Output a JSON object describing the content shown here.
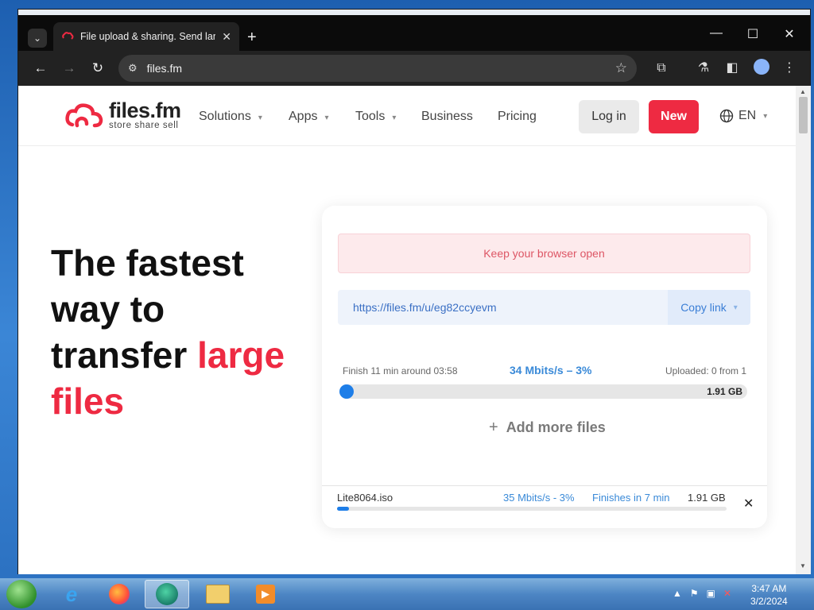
{
  "browser": {
    "tab_title": "File upload & sharing. Send lar",
    "url": "files.fm",
    "new_tab": "+",
    "window_controls": {
      "minimize": "—",
      "maximize": "☐",
      "close": "✕"
    }
  },
  "site": {
    "brand": "files.fm",
    "tagline": "store share sell",
    "nav": [
      "Solutions",
      "Apps",
      "Tools",
      "Business",
      "Pricing"
    ],
    "login": "Log in",
    "new": "New",
    "language": "EN",
    "brand_color": "#ee2a42"
  },
  "hero": {
    "line1": "The fastest",
    "line2": "way to",
    "line3_plain": "transfer ",
    "line3_accent": "large",
    "line4_accent": "files"
  },
  "upload": {
    "warning": "Keep your browser open",
    "share_link": "https://files.fm/u/eg82ccyevm",
    "copy_label": "Copy link",
    "finish_text": "Finish 11 min around 03:58",
    "speed_text": "34 Mbits/s – 3%",
    "uploaded_text": "Uploaded: 0 from 1",
    "total_size": "1.91 GB",
    "progress_percent": 3,
    "add_more": "Add more files"
  },
  "file": {
    "name": "Lite8064.iso",
    "speed": "35 Mbits/s - 3%",
    "finishes": "Finishes in 7 min",
    "size": "1.91 GB",
    "progress_percent": 3
  },
  "taskbar": {
    "time": "3:47 AM",
    "date": "3/2/2024",
    "apps": [
      "internet-explorer-icon",
      "firefox-icon",
      "app-icon",
      "file-explorer-icon",
      "media-player-icon"
    ]
  }
}
